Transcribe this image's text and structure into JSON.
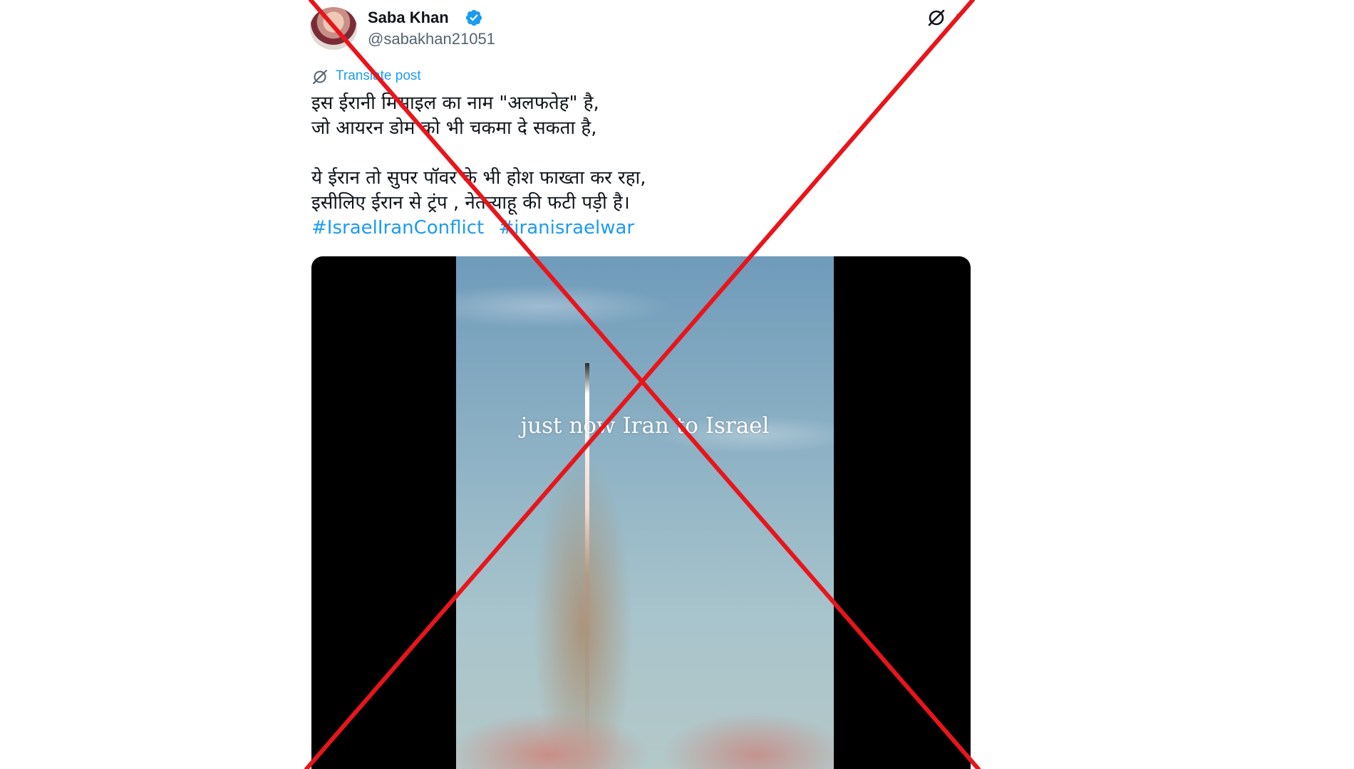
{
  "post": {
    "author_name": "Saba Khan",
    "handle": "@sabakhan21051",
    "translate_label": "Translate post",
    "text_lines": [
      "इस ईरानी मिसाइल का नाम \"अलफतेह\" है,",
      "जो आयरन डोम को भी चकमा दे सकता है,",
      "ये ईरान तो सुपर पॉवर के भी होश फाख्ता कर रहा,",
      "इसीलिए ईरान से  ट्रंप , नेतन्याहू की फटी पड़ी है।"
    ],
    "hashtags": [
      "#IsraelIranConflict",
      "#iranisraelwar"
    ],
    "more_glyph": "·"
  },
  "media": {
    "caption": "just now Iran to Israel"
  },
  "icons": {
    "verified": "verified-badge-icon",
    "grok": "grok-icon",
    "more": "more-options-icon",
    "translate": "translate-icon"
  },
  "colors": {
    "link": "#1d9bf0",
    "verified": "#1d9bf0",
    "overlay_x": "#e8151b",
    "text_primary": "#0f1419",
    "text_secondary": "#536471"
  }
}
